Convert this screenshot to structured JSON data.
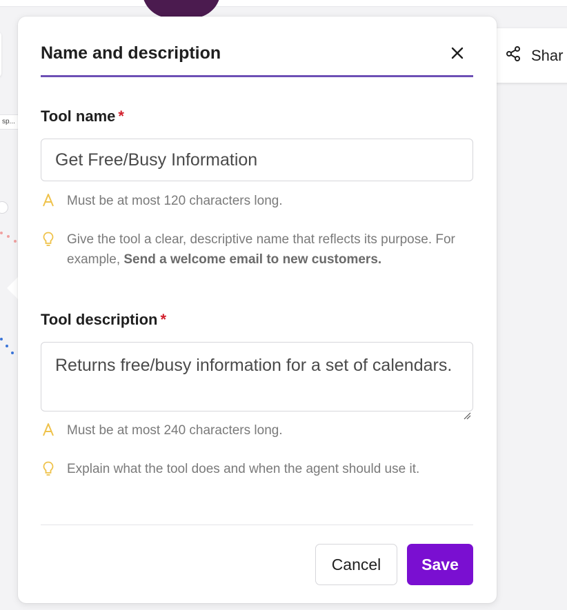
{
  "background": {
    "left_chip_text": "sp...",
    "share_button_label": "Shar"
  },
  "modal": {
    "title": "Name and description",
    "close_icon": "close-icon",
    "accent_color": "#6d4fb5",
    "tool_name": {
      "label": "Tool name",
      "required_mark": "*",
      "value": "Get Free/Busy Information",
      "limit_hint": "Must be at most 120 characters long.",
      "tip_prefix": "Give the tool a clear, descriptive name that reflects its purpose. For example, ",
      "tip_example": "Send a welcome email to new customers."
    },
    "tool_description": {
      "label": "Tool description",
      "required_mark": "*",
      "value": "Returns free/busy information for a set of calendars.",
      "limit_hint": "Must be at most 240 characters long.",
      "tip": "Explain what the tool does and when the agent should use it."
    },
    "buttons": {
      "cancel": "Cancel",
      "save": "Save",
      "save_color": "#7a0fd1"
    }
  },
  "icons": {
    "limit": "font-size-icon",
    "tip": "lightbulb-icon",
    "share": "share-icon"
  }
}
